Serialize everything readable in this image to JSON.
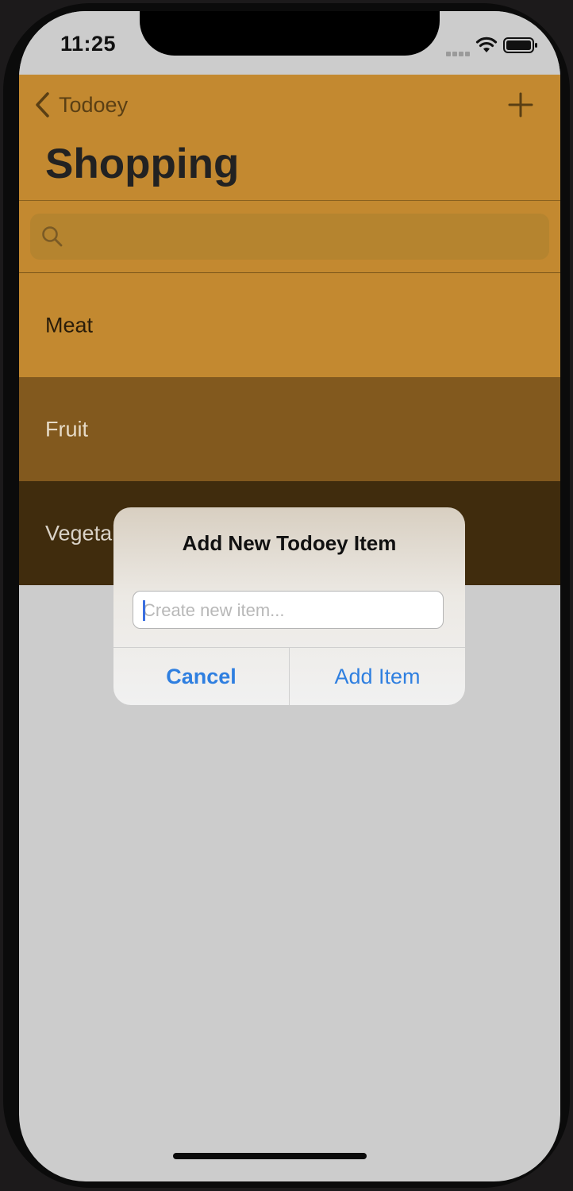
{
  "status_bar": {
    "time": "11:25"
  },
  "nav": {
    "back_label": "Todoey",
    "title": "Shopping",
    "add_icon": "plus-icon",
    "back_icon": "chevron-left-icon"
  },
  "search": {
    "placeholder": "",
    "icon": "search-icon"
  },
  "list": {
    "items": [
      {
        "label": "Meat",
        "bg": "#c38930",
        "color": "#2a1d0a"
      },
      {
        "label": "Fruit",
        "bg": "#82591e",
        "color": "#e6dac6"
      },
      {
        "label": "Vegetables",
        "bg": "#402c0d",
        "color": "#d9d2c7"
      }
    ]
  },
  "alert": {
    "title": "Add New Todoey Item",
    "input_placeholder": "Create new item...",
    "cancel_label": "Cancel",
    "confirm_label": "Add Item"
  },
  "colors": {
    "accent_blue": "#2f7fe0",
    "nav_bg": "#c38930",
    "screen_bg": "#cccccc"
  }
}
